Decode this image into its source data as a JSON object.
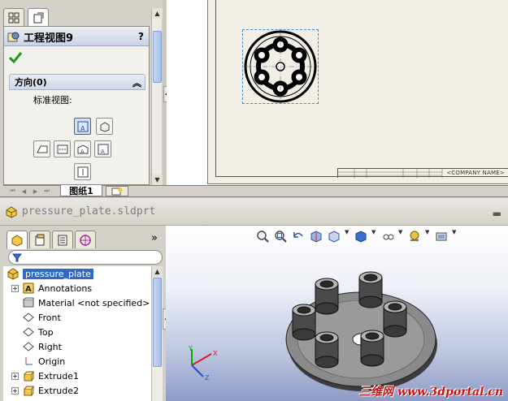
{
  "drawing": {
    "property_manager": {
      "title": "工程视图9",
      "help": "?",
      "ok_icon": "checkmark-icon",
      "orientation_section": {
        "title": "方向(0)",
        "standard_views_label": "标准视图:"
      }
    },
    "sheet_tab": "图纸1",
    "title_block": {
      "company_name": "<COMPANY NAME>"
    }
  },
  "part": {
    "title": "pressure_plate.sldprt",
    "tree": {
      "root": "pressure_plate",
      "items": [
        {
          "label": "Annotations",
          "icon": "annotations-icon",
          "expandable": true
        },
        {
          "label": "Material <not specified>",
          "icon": "material-icon",
          "expandable": false
        },
        {
          "label": "Front",
          "icon": "plane-icon",
          "expandable": false
        },
        {
          "label": "Top",
          "icon": "plane-icon",
          "expandable": false
        },
        {
          "label": "Right",
          "icon": "plane-icon",
          "expandable": false
        },
        {
          "label": "Origin",
          "icon": "origin-icon",
          "expandable": false
        },
        {
          "label": "Extrude1",
          "icon": "extrude-icon",
          "expandable": true
        },
        {
          "label": "Extrude2",
          "icon": "extrude-icon",
          "expandable": true
        }
      ]
    },
    "more_tabs": "»"
  },
  "triad": {
    "x": "X",
    "y": "Y",
    "z": "Z"
  },
  "watermark": "三维网 www.3dportal.cn"
}
